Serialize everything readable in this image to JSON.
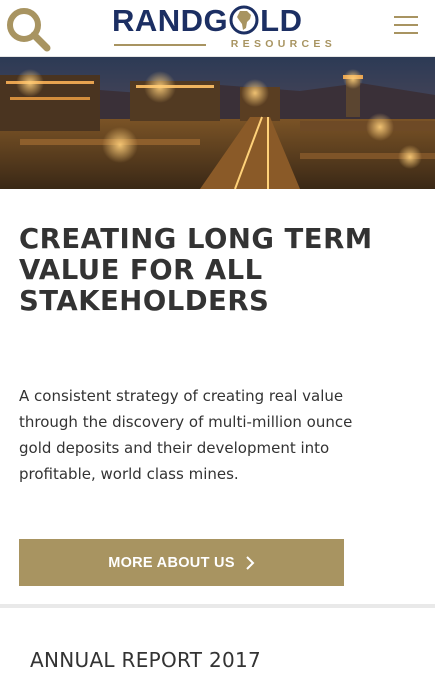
{
  "header": {
    "logo_text_left": "RANDG",
    "logo_text_right": "LD",
    "logo_subtext": "RESOURCES",
    "search_icon": "search-icon",
    "menu_icon": "hamburger-menu-icon"
  },
  "hero": {
    "image_icon": "night-mine-photo"
  },
  "main": {
    "headline": "CREATING LONG TERM VALUE FOR ALL STAKEHOLDERS",
    "intro": "A consistent strategy of creating real value through the discovery of multi-million ounce gold deposits and their development into profitable, world class mines.",
    "cta_label": "MORE ABOUT US",
    "cta_icon": "chevron-right-icon"
  },
  "section": {
    "annual_report": "ANNUAL REPORT 2017"
  },
  "colors": {
    "gold": "#a89461",
    "navy": "#1c2f63",
    "text": "#333333"
  }
}
